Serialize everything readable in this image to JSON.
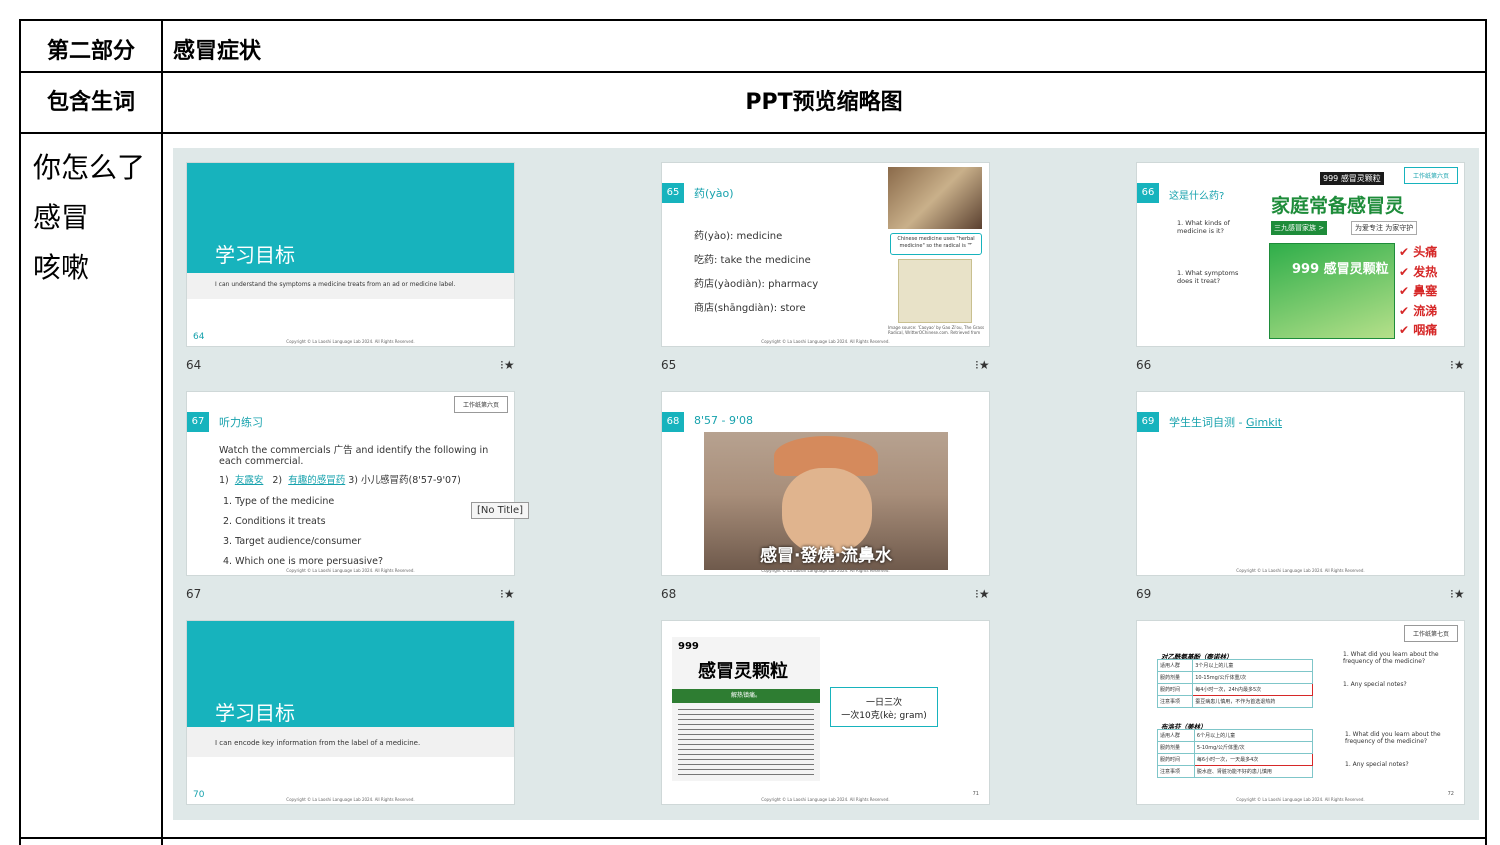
{
  "section": {
    "label": "第二部分",
    "title": "感冒症状"
  },
  "vocab_header": "包含生词",
  "ppt_header": "PPT预览缩略图",
  "vocab_words": [
    "你怎么了",
    "感冒",
    "咳嗽"
  ],
  "copyright": "Copyright © La Laoshi Language Lab 2024. All Rights Reserved.",
  "slides": {
    "s64": {
      "num": "64",
      "title": "学习目标",
      "subtitle": "I can understand the symptoms a medicine treats from an ad or medicine label.",
      "page": "64"
    },
    "s65": {
      "num": "65",
      "title": "药(yào)",
      "lines": [
        "药(yào): medicine",
        "吃药:  take the medicine",
        "药店(yàodiàn): pharmacy",
        "商店(shāngdiàn): store"
      ],
      "caption": "Chinese medicine uses \"herbal medicine\" so the radical is 艹",
      "source": "Image source: 'Caoyao' by Gao Zi'ou, The Grass Radical, WritterOChinese.com. Retrieved from"
    },
    "s66": {
      "num": "66",
      "title": "这是什么药?",
      "q1": "1.   What kinds of medicine is it?",
      "q2": "1.   What symptoms does it treat?",
      "tag": "工作纸第六页",
      "brand": "999 感冒灵颗粒",
      "ad_title": "家庭常备感冒灵",
      "ad_sub1": "三九感冒家族 >",
      "ad_sub2": "为爱专注 为家守护",
      "box": "999 感冒灵颗粒",
      "symptoms": [
        "头痛",
        "发热",
        "鼻塞",
        "流涕",
        "咽痛"
      ]
    },
    "s67": {
      "num": "67",
      "title": "听力练习",
      "tag": "工作纸第六页",
      "intro": "Watch the commercials 广告 and identify the following in each commercial.",
      "ads_prefix": "1)",
      "ad1": "友露安",
      "ads_mid": "2)",
      "ad2": "有趣的感冒药",
      "ad3": "3) 小儿感冒药(8'57-9'07)",
      "items": [
        "1.  Type of the medicine",
        "2.  Conditions it treats",
        "3.  Target audience/consumer",
        "4.  Which one is more persuasive?"
      ],
      "tooltip": "[No Title]"
    },
    "s68": {
      "num": "68",
      "title": "8'57 - 9'08",
      "caption": "感冒·發燒·流鼻水"
    },
    "s69": {
      "num": "69",
      "title": "学生生词自测 - ",
      "link": "Gimkit"
    },
    "s70": {
      "num": "70",
      "title": "学习目标",
      "subtitle": "I can encode key information from the label of a medicine.",
      "page": "70"
    },
    "s71": {
      "brand": "999",
      "title": "感冒灵颗粒",
      "band": "解热镇痛。",
      "callout1": "一日三次",
      "callout2": "一次10克(kè; gram)",
      "page": "71"
    },
    "s72": {
      "tag": "工作纸第七页",
      "med1": "对乙酰氨基酚（泰诺林）",
      "rows1": [
        [
          "适用人群",
          "3个月以上的儿童"
        ],
        [
          "服药剂量",
          "10-15mg/公斤体重/次"
        ],
        [
          "服药时间",
          "每4小时一次，24h内最多5次"
        ],
        [
          "注意事项",
          "蚕豆病患儿慎用，不作为首选退热药"
        ]
      ],
      "med2": "布洛芬（美林）",
      "rows2": [
        [
          "适用人群",
          "6个月以上的儿童"
        ],
        [
          "服药剂量",
          "5-10mg/公斤体重/次"
        ],
        [
          "服药时间",
          "每6小时一次，一天最多4次"
        ],
        [
          "注意事项",
          "脱水症、肾脏功能不好的患儿慎用"
        ]
      ],
      "qa": "1.   What did you learn about the frequency of the medicine?",
      "qb": "1.   Any special notes?",
      "page": "72"
    }
  },
  "labels": [
    "64",
    "65",
    "66",
    "67",
    "68",
    "69"
  ],
  "star_glyph": "⁝★"
}
